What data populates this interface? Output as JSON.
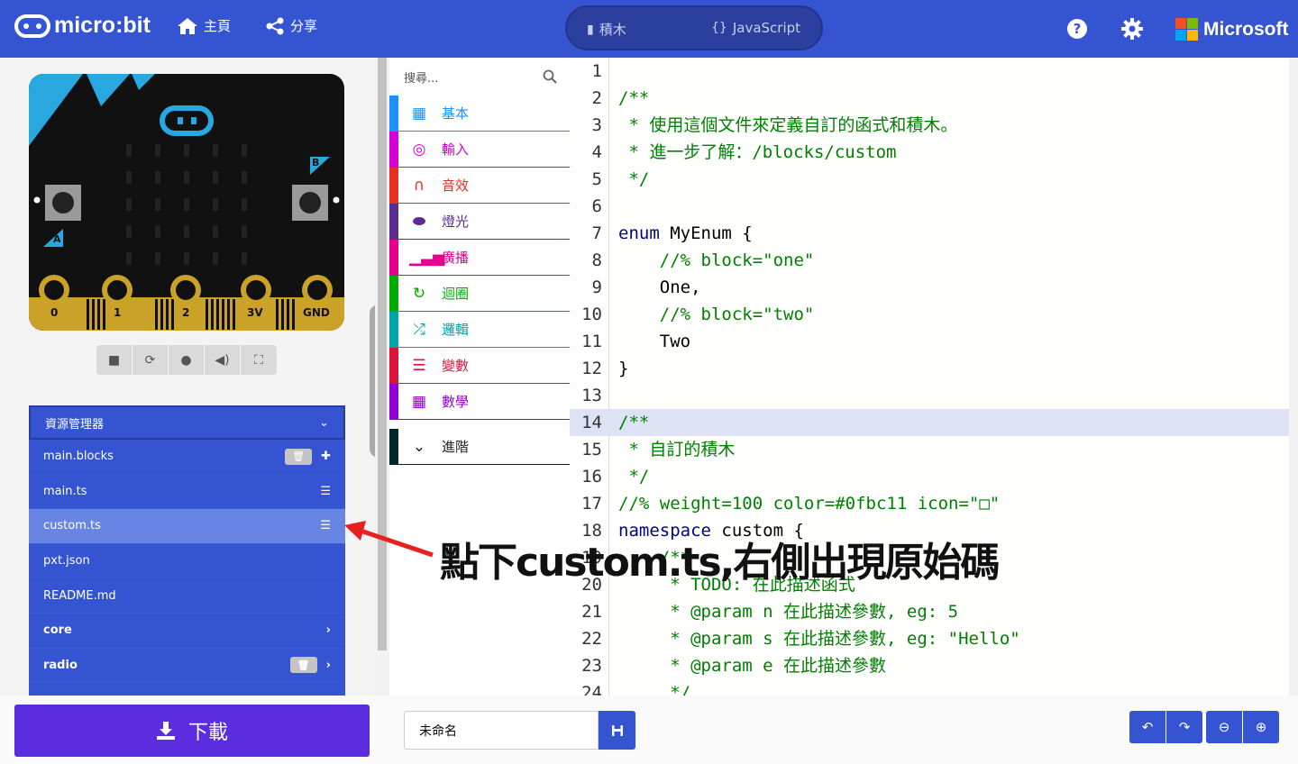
{
  "header": {
    "logo": "micro:bit",
    "home_label": "主頁",
    "share_label": "分享",
    "tab_blocks": "積木",
    "tab_js": "JavaScript",
    "js_glyph": "{}",
    "brand": "Microsoft",
    "colors": {
      "bar": "#3454d1",
      "toggle": "#2a3f9e"
    }
  },
  "simulator": {
    "pin_labels": [
      "0",
      "1",
      "2",
      "3V",
      "GND"
    ],
    "button_a": "A",
    "button_b": "B",
    "controls": [
      "stop-icon",
      "restart-icon",
      "debug-icon",
      "mute-icon",
      "fullscreen-icon"
    ]
  },
  "explorer": {
    "title": "資源管理器",
    "files": [
      {
        "name": "main.blocks",
        "icon": "puzzle-icon",
        "trash": true
      },
      {
        "name": "main.ts",
        "icon": "list-icon"
      },
      {
        "name": "custom.ts",
        "icon": "list-icon",
        "selected": true
      },
      {
        "name": "pxt.json"
      },
      {
        "name": "README.md"
      },
      {
        "name": "core",
        "icon": "chevron-right-icon",
        "bold": true
      },
      {
        "name": "radio",
        "icon": "chevron-right-icon",
        "trash": true,
        "bold": true
      }
    ]
  },
  "toolbox": {
    "search_placeholder": "搜尋...",
    "categories": [
      {
        "label": "基本",
        "color": "#1e90ff",
        "icon": "grid-icon"
      },
      {
        "label": "輸入",
        "color": "#d400d4",
        "icon": "target-icon"
      },
      {
        "label": "音效",
        "color": "#e63022",
        "icon": "headphones-icon"
      },
      {
        "label": "燈光",
        "color": "#5c2d91",
        "icon": "toggle-icon"
      },
      {
        "label": "廣播",
        "color": "#e3008c",
        "icon": "signal-icon"
      },
      {
        "label": "迴圈",
        "color": "#00aa00",
        "icon": "loop-icon"
      },
      {
        "label": "邏輯",
        "color": "#00a4a6",
        "icon": "shuffle-icon"
      },
      {
        "label": "變數",
        "color": "#dc143c",
        "icon": "bars-icon"
      },
      {
        "label": "數學",
        "color": "#9400d3",
        "icon": "calculator-icon"
      }
    ],
    "advanced": {
      "label": "進階",
      "color": "#00272b",
      "icon": "chevron-down-icon"
    }
  },
  "editor": {
    "lines": [
      {
        "n": "1",
        "segs": []
      },
      {
        "n": "2",
        "segs": [
          {
            "t": "/**",
            "c": "cm"
          }
        ]
      },
      {
        "n": "3",
        "segs": [
          {
            "t": " * 使用這個文件來定義自訂的函式和積木。",
            "c": "cm"
          }
        ]
      },
      {
        "n": "4",
        "segs": [
          {
            "t": " * 進一步了解：/blocks/custom",
            "c": "cm"
          }
        ]
      },
      {
        "n": "5",
        "segs": [
          {
            "t": " */",
            "c": "cm"
          }
        ]
      },
      {
        "n": "6",
        "segs": []
      },
      {
        "n": "7",
        "segs": [
          {
            "t": "enum",
            "c": "kw"
          },
          {
            "t": " MyEnum {",
            "c": "tx"
          }
        ]
      },
      {
        "n": "8",
        "segs": [
          {
            "t": "    //% block=\"one\"",
            "c": "cm"
          }
        ]
      },
      {
        "n": "9",
        "segs": [
          {
            "t": "    One,",
            "c": "tx"
          }
        ]
      },
      {
        "n": "10",
        "segs": [
          {
            "t": "    //% block=\"two\"",
            "c": "cm"
          }
        ]
      },
      {
        "n": "11",
        "segs": [
          {
            "t": "    Two",
            "c": "tx"
          }
        ]
      },
      {
        "n": "12",
        "segs": [
          {
            "t": "}",
            "c": "tx"
          }
        ]
      },
      {
        "n": "13",
        "segs": []
      },
      {
        "n": "14",
        "segs": [
          {
            "t": "/**",
            "c": "cm"
          }
        ],
        "hl": true
      },
      {
        "n": "15",
        "segs": [
          {
            "t": " * 自訂的積木",
            "c": "cm"
          }
        ]
      },
      {
        "n": "16",
        "segs": [
          {
            "t": " */",
            "c": "cm"
          }
        ]
      },
      {
        "n": "17",
        "segs": [
          {
            "t": "//% weight=100 color=#0fbc11 icon=\"□\"",
            "c": "cm"
          }
        ]
      },
      {
        "n": "18",
        "segs": [
          {
            "t": "namespace",
            "c": "kw"
          },
          {
            "t": " custom {",
            "c": "tx"
          }
        ]
      },
      {
        "n": "19",
        "segs": [
          {
            "t": "    /**",
            "c": "cm"
          }
        ]
      },
      {
        "n": "20",
        "segs": [
          {
            "t": "     * TODO: 在此描述函式",
            "c": "cm"
          }
        ]
      },
      {
        "n": "21",
        "segs": [
          {
            "t": "     * @param n 在此描述參數, eg: 5",
            "c": "cm"
          }
        ]
      },
      {
        "n": "22",
        "segs": [
          {
            "t": "     * @param s 在此描述參數, eg: \"Hello\"",
            "c": "cm"
          }
        ]
      },
      {
        "n": "23",
        "segs": [
          {
            "t": "     * @param e 在此描述參數",
            "c": "cm"
          }
        ]
      },
      {
        "n": "24",
        "segs": [
          {
            "t": "     */",
            "c": "cm"
          }
        ]
      }
    ]
  },
  "footer": {
    "download_label": "下載",
    "project_name": "未命名"
  },
  "annotation": {
    "text": "點下custom.ts,右側出現原始碼",
    "arrow_color": "#e8201f"
  }
}
